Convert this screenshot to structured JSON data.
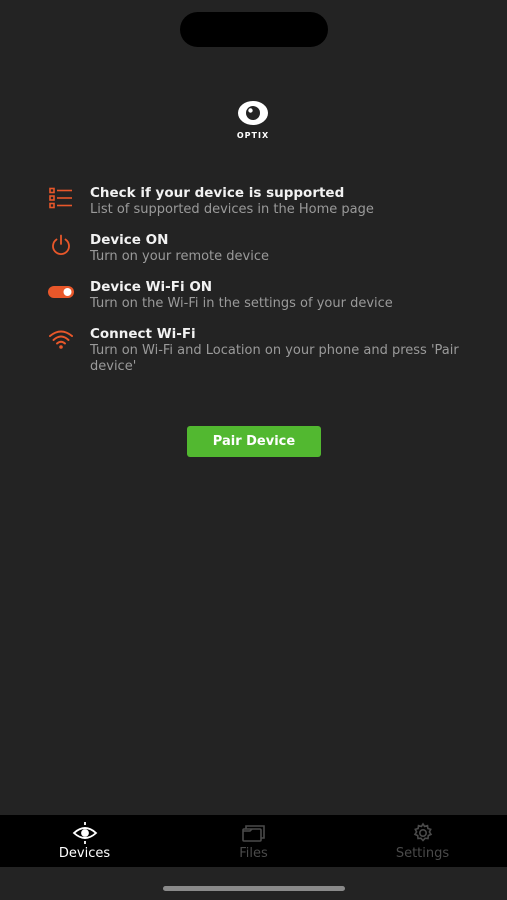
{
  "brand": {
    "logo_text": "OPTIX"
  },
  "steps": [
    {
      "icon": "checklist-icon",
      "title": "Check if your device is supported",
      "desc": "List of supported devices in the Home page"
    },
    {
      "icon": "power-icon",
      "title": "Device ON",
      "desc": "Turn on your remote device"
    },
    {
      "icon": "toggle-icon",
      "title": "Device Wi-Fi ON",
      "desc": "Turn on the Wi-Fi in the settings of your device"
    },
    {
      "icon": "wifi-icon",
      "title": "Connect Wi-Fi",
      "desc": "Turn on Wi-Fi and Location on your phone and press 'Pair device'"
    }
  ],
  "pair_button": {
    "label": "Pair Device"
  },
  "tabs": [
    {
      "label": "Devices",
      "icon": "eye-target-icon",
      "active": true
    },
    {
      "label": "Files",
      "icon": "folders-icon",
      "active": false
    },
    {
      "label": "Settings",
      "icon": "gear-icon",
      "active": false
    }
  ],
  "colors": {
    "accent": "#e8572a",
    "primary_button": "#52b830",
    "background": "#232323"
  }
}
